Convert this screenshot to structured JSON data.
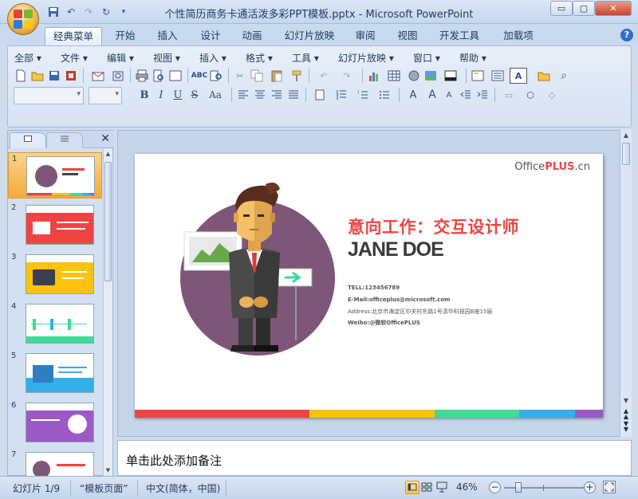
{
  "window": {
    "title": "个性简历商务卡通活泼多彩PPT模板.pptx - Microsoft PowerPoint",
    "min_label": "▭",
    "max_label": "▢",
    "close_label": "✕"
  },
  "tabs": [
    "经典菜单",
    "开始",
    "插入",
    "设计",
    "动画",
    "幻灯片放映",
    "审阅",
    "视图",
    "开发工具",
    "加载项"
  ],
  "menus": [
    "全部 ▾",
    "文件 ▾",
    "编辑 ▾",
    "视图 ▾",
    "插入 ▾",
    "格式 ▾",
    "工具 ▾",
    "幻灯片放映 ▾",
    "窗口 ▾",
    "帮助 ▾"
  ],
  "formatting": {
    "bold": "B",
    "italic": "I",
    "underline": "U",
    "strike": "S",
    "case": "Aa"
  },
  "slide_numbers": [
    "1",
    "2",
    "3",
    "4",
    "5",
    "6",
    "7"
  ],
  "slide": {
    "brand_office": "Office",
    "brand_plus": "PLUS",
    "brand_cn": ".cn",
    "heading": "意向工作：交互设计师",
    "name": "JANE DOE",
    "tel": "TELL:123456789",
    "email": "E-Mail:officeplus@microsoft.com",
    "address": "Address:北京市海淀区中关村东路1号清华科技园B座15层",
    "weibo": "Weibo:@微软OfficePLUS"
  },
  "notes_placeholder": "单击此处添加备注",
  "status": {
    "slide": "幻灯片 1/9",
    "theme": "“模板页面”",
    "language": "中文(简体，中国)",
    "zoom": "46%"
  },
  "colors": {
    "red": "#ee4444",
    "yellow": "#fdc30b",
    "green": "#3ddc97",
    "blue": "#33aee8",
    "purple": "#9b59c5",
    "circle": "#7e5677"
  }
}
